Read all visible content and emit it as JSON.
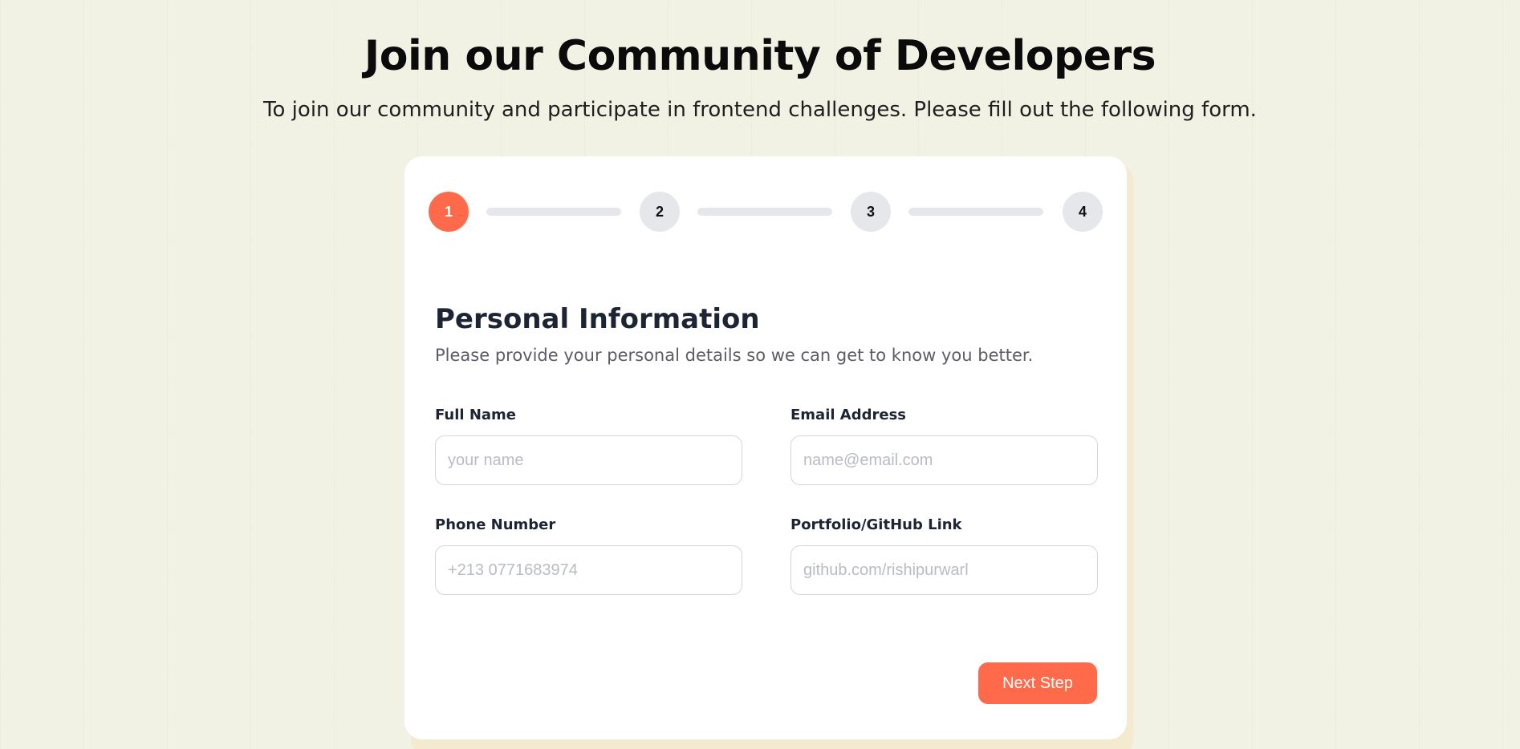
{
  "header": {
    "title": "Join our Community of Developers",
    "subtitle": "To join our community and participate in frontend challenges. Please fill out the following form."
  },
  "stepper": {
    "current_step": 1,
    "steps": [
      {
        "label": "1"
      },
      {
        "label": "2"
      },
      {
        "label": "3"
      },
      {
        "label": "4"
      }
    ]
  },
  "form": {
    "section_title": "Personal Information",
    "section_description": "Please provide your personal details so we can get to know you better.",
    "fields": {
      "full_name": {
        "label": "Full Name",
        "placeholder": "your name",
        "value": ""
      },
      "email": {
        "label": "Email Address",
        "placeholder": "name@email.com",
        "value": ""
      },
      "phone": {
        "label": "Phone Number",
        "placeholder": "+213 0771683974",
        "value": ""
      },
      "portfolio": {
        "label": "Portfolio/GitHub Link",
        "placeholder": "github.com/rishipurwarl",
        "value": ""
      }
    },
    "next_label": "Next Step"
  },
  "colors": {
    "accent": "#ff6b4a",
    "page_background": "#f1f1e4",
    "card_background": "#ffffff",
    "inactive_step": "#e6e7eb"
  }
}
